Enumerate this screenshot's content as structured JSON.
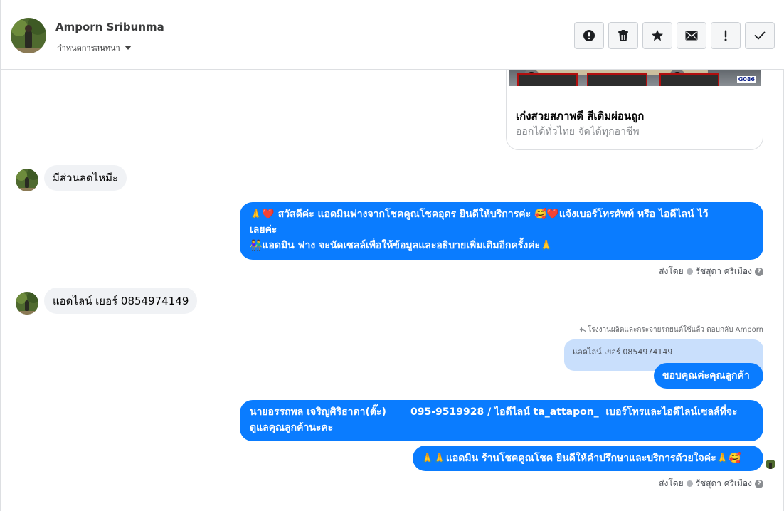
{
  "header": {
    "contact_name": "Amporn Sribunma",
    "assign_label": "กำหนดการสนทนา",
    "actions": [
      {
        "name": "report-icon",
        "glyph": "exclamation-circle"
      },
      {
        "name": "trash-icon",
        "glyph": "trash"
      },
      {
        "name": "star-icon",
        "glyph": "star"
      },
      {
        "name": "mail-icon",
        "glyph": "envelope"
      },
      {
        "name": "alert-icon",
        "glyph": "exclamation"
      },
      {
        "name": "check-icon",
        "glyph": "checkmark"
      }
    ]
  },
  "thread": {
    "link_card": {
      "title": "เก๋งสวยสภาพดี สีเดิมผ่อนถูก",
      "description": "ออกได้ทั่วไทย จัดได้ทุกอาชีพ",
      "image_code": "G086"
    },
    "msg_in_1": "มีส่วนลดไหมีะ",
    "msg_out_1": {
      "line1": "🙏❤️ สวัสดีค่ะ แอดมินฟางจากโชคคูณโชคอุดร ยินดีให้บริการค่ะ 🥰❤️แจ้งเบอร์โทรศัพท์ หรือ ไอดีไลน์ ไว้",
      "line2": "เลยค่ะ",
      "line3": "👫แอดมิน ฟาง จะนัดเซลล์เพื่อให้ข้อมูลและอธิบายเพิ่มเติมอีกครั้งค่ะ🙏"
    },
    "sent_by_1": {
      "label": "ส่งโดย",
      "name": "รัชสุดา ศรีเมือง"
    },
    "msg_in_2": "แอดไลน์ เยอร์ 0854974149",
    "reply_note": "โรงงานผลิตและกระจายรถยนต์ใช้แล้ว ตอบกลับ Amporn",
    "quoted_text": "แอดไลน์ เยอร์ 0854974149",
    "msg_out_2": "ขอบคุณค่ะคุณลูกค้า",
    "msg_out_3": {
      "line1": "นายอรรถพล เจริญศิริธาดา(ตั๊ะ)       095-9519928 / ไอดีไลน์ ta_attapon_  เบอร์โทรและไอดีไลน์เซลล์ที่จะ",
      "line2": "ดูแลคุณลูกค้านะคะ"
    },
    "msg_out_4": "🙏🙏แอดมิน ร้านโชคคูณโชค ยินดีให้คำปรึกษาและบริการด้วยใจค่ะ🙏🥰",
    "sent_by_2": {
      "label": "ส่งโดย",
      "name": "รัชสุดา ศรีเมือง"
    }
  },
  "colors": {
    "outgoing_bubble": "#0a7cff",
    "incoming_bubble": "#f0f2f5",
    "quoted_bubble": "#c9dffc"
  }
}
